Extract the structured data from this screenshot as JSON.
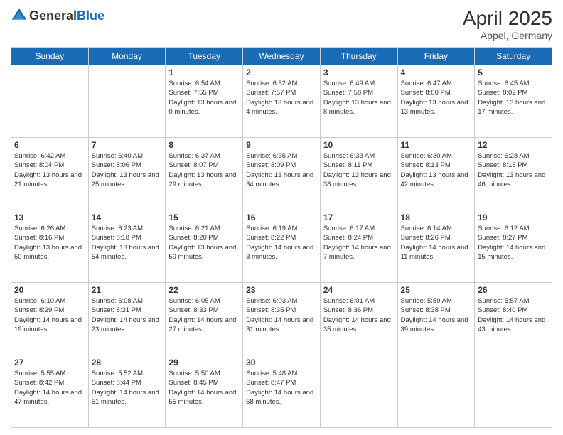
{
  "logo": {
    "general": "General",
    "blue": "Blue"
  },
  "header": {
    "month_year": "April 2025",
    "location": "Appel, Germany"
  },
  "days_of_week": [
    "Sunday",
    "Monday",
    "Tuesday",
    "Wednesday",
    "Thursday",
    "Friday",
    "Saturday"
  ],
  "weeks": [
    [
      {
        "day": "",
        "sunrise": "",
        "sunset": "",
        "daylight": ""
      },
      {
        "day": "",
        "sunrise": "",
        "sunset": "",
        "daylight": ""
      },
      {
        "day": "1",
        "sunrise": "Sunrise: 6:54 AM",
        "sunset": "Sunset: 7:55 PM",
        "daylight": "Daylight: 13 hours and 0 minutes."
      },
      {
        "day": "2",
        "sunrise": "Sunrise: 6:52 AM",
        "sunset": "Sunset: 7:57 PM",
        "daylight": "Daylight: 13 hours and 4 minutes."
      },
      {
        "day": "3",
        "sunrise": "Sunrise: 6:49 AM",
        "sunset": "Sunset: 7:58 PM",
        "daylight": "Daylight: 13 hours and 8 minutes."
      },
      {
        "day": "4",
        "sunrise": "Sunrise: 6:47 AM",
        "sunset": "Sunset: 8:00 PM",
        "daylight": "Daylight: 13 hours and 13 minutes."
      },
      {
        "day": "5",
        "sunrise": "Sunrise: 6:45 AM",
        "sunset": "Sunset: 8:02 PM",
        "daylight": "Daylight: 13 hours and 17 minutes."
      }
    ],
    [
      {
        "day": "6",
        "sunrise": "Sunrise: 6:42 AM",
        "sunset": "Sunset: 8:04 PM",
        "daylight": "Daylight: 13 hours and 21 minutes."
      },
      {
        "day": "7",
        "sunrise": "Sunrise: 6:40 AM",
        "sunset": "Sunset: 8:06 PM",
        "daylight": "Daylight: 13 hours and 25 minutes."
      },
      {
        "day": "8",
        "sunrise": "Sunrise: 6:37 AM",
        "sunset": "Sunset: 8:07 PM",
        "daylight": "Daylight: 13 hours and 29 minutes."
      },
      {
        "day": "9",
        "sunrise": "Sunrise: 6:35 AM",
        "sunset": "Sunset: 8:09 PM",
        "daylight": "Daylight: 13 hours and 34 minutes."
      },
      {
        "day": "10",
        "sunrise": "Sunrise: 6:33 AM",
        "sunset": "Sunset: 8:11 PM",
        "daylight": "Daylight: 13 hours and 38 minutes."
      },
      {
        "day": "11",
        "sunrise": "Sunrise: 6:30 AM",
        "sunset": "Sunset: 8:13 PM",
        "daylight": "Daylight: 13 hours and 42 minutes."
      },
      {
        "day": "12",
        "sunrise": "Sunrise: 6:28 AM",
        "sunset": "Sunset: 8:15 PM",
        "daylight": "Daylight: 13 hours and 46 minutes."
      }
    ],
    [
      {
        "day": "13",
        "sunrise": "Sunrise: 6:26 AM",
        "sunset": "Sunset: 8:16 PM",
        "daylight": "Daylight: 13 hours and 50 minutes."
      },
      {
        "day": "14",
        "sunrise": "Sunrise: 6:23 AM",
        "sunset": "Sunset: 8:18 PM",
        "daylight": "Daylight: 13 hours and 54 minutes."
      },
      {
        "day": "15",
        "sunrise": "Sunrise: 6:21 AM",
        "sunset": "Sunset: 8:20 PM",
        "daylight": "Daylight: 13 hours and 59 minutes."
      },
      {
        "day": "16",
        "sunrise": "Sunrise: 6:19 AM",
        "sunset": "Sunset: 8:22 PM",
        "daylight": "Daylight: 14 hours and 3 minutes."
      },
      {
        "day": "17",
        "sunrise": "Sunrise: 6:17 AM",
        "sunset": "Sunset: 8:24 PM",
        "daylight": "Daylight: 14 hours and 7 minutes."
      },
      {
        "day": "18",
        "sunrise": "Sunrise: 6:14 AM",
        "sunset": "Sunset: 8:26 PM",
        "daylight": "Daylight: 14 hours and 11 minutes."
      },
      {
        "day": "19",
        "sunrise": "Sunrise: 6:12 AM",
        "sunset": "Sunset: 8:27 PM",
        "daylight": "Daylight: 14 hours and 15 minutes."
      }
    ],
    [
      {
        "day": "20",
        "sunrise": "Sunrise: 6:10 AM",
        "sunset": "Sunset: 8:29 PM",
        "daylight": "Daylight: 14 hours and 19 minutes."
      },
      {
        "day": "21",
        "sunrise": "Sunrise: 6:08 AM",
        "sunset": "Sunset: 8:31 PM",
        "daylight": "Daylight: 14 hours and 23 minutes."
      },
      {
        "day": "22",
        "sunrise": "Sunrise: 6:05 AM",
        "sunset": "Sunset: 8:33 PM",
        "daylight": "Daylight: 14 hours and 27 minutes."
      },
      {
        "day": "23",
        "sunrise": "Sunrise: 6:03 AM",
        "sunset": "Sunset: 8:35 PM",
        "daylight": "Daylight: 14 hours and 31 minutes."
      },
      {
        "day": "24",
        "sunrise": "Sunrise: 6:01 AM",
        "sunset": "Sunset: 8:36 PM",
        "daylight": "Daylight: 14 hours and 35 minutes."
      },
      {
        "day": "25",
        "sunrise": "Sunrise: 5:59 AM",
        "sunset": "Sunset: 8:38 PM",
        "daylight": "Daylight: 14 hours and 39 minutes."
      },
      {
        "day": "26",
        "sunrise": "Sunrise: 5:57 AM",
        "sunset": "Sunset: 8:40 PM",
        "daylight": "Daylight: 14 hours and 43 minutes."
      }
    ],
    [
      {
        "day": "27",
        "sunrise": "Sunrise: 5:55 AM",
        "sunset": "Sunset: 8:42 PM",
        "daylight": "Daylight: 14 hours and 47 minutes."
      },
      {
        "day": "28",
        "sunrise": "Sunrise: 5:52 AM",
        "sunset": "Sunset: 8:44 PM",
        "daylight": "Daylight: 14 hours and 51 minutes."
      },
      {
        "day": "29",
        "sunrise": "Sunrise: 5:50 AM",
        "sunset": "Sunset: 8:45 PM",
        "daylight": "Daylight: 14 hours and 55 minutes."
      },
      {
        "day": "30",
        "sunrise": "Sunrise: 5:48 AM",
        "sunset": "Sunset: 8:47 PM",
        "daylight": "Daylight: 14 hours and 58 minutes."
      },
      {
        "day": "",
        "sunrise": "",
        "sunset": "",
        "daylight": ""
      },
      {
        "day": "",
        "sunrise": "",
        "sunset": "",
        "daylight": ""
      },
      {
        "day": "",
        "sunrise": "",
        "sunset": "",
        "daylight": ""
      }
    ]
  ]
}
